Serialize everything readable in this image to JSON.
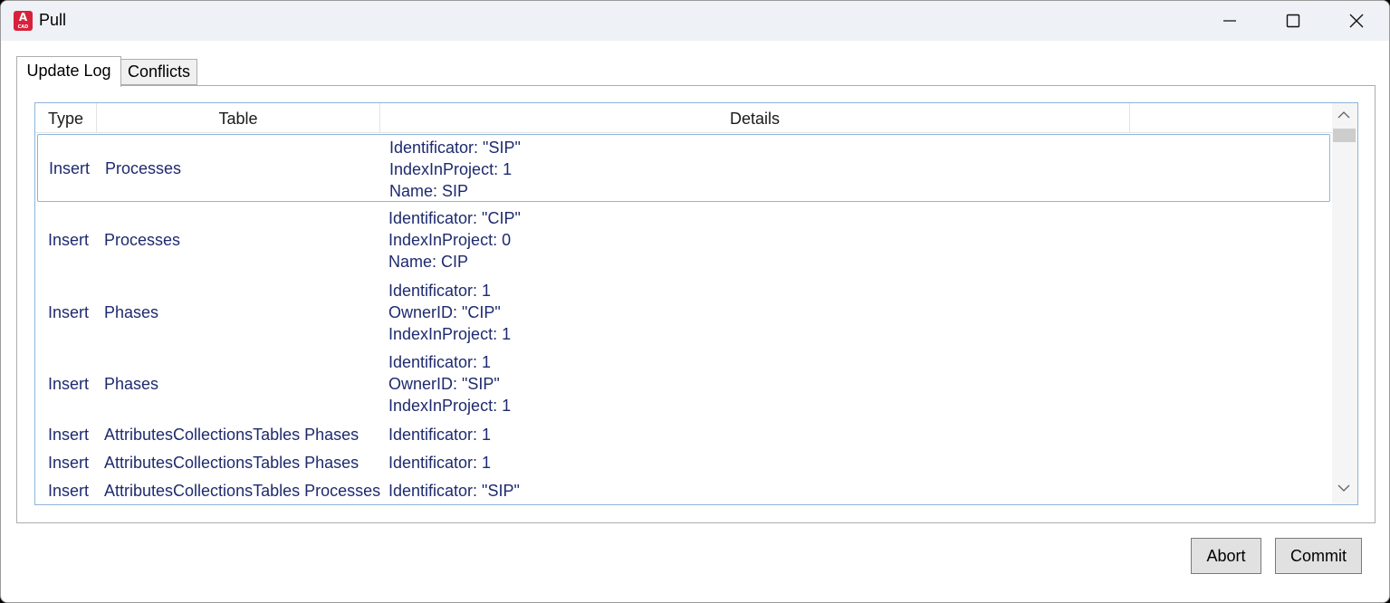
{
  "window": {
    "title": "Pull",
    "icon_letter": "A",
    "icon_sub": "CAD",
    "accent": "#d8213a"
  },
  "tabs": [
    {
      "label": "Update Log",
      "active": true
    },
    {
      "label": "Conflicts",
      "active": false
    }
  ],
  "grid": {
    "columns": [
      "Type",
      "Table",
      "Details",
      ""
    ],
    "rows": [
      {
        "type": "Insert",
        "table": "Processes",
        "details": [
          "Identificator: \"SIP\"",
          "IndexInProject: 1",
          "Name: SIP"
        ]
      },
      {
        "type": "Insert",
        "table": "Processes",
        "details": [
          "Identificator: \"CIP\"",
          "IndexInProject: 0",
          "Name: CIP"
        ]
      },
      {
        "type": "Insert",
        "table": "Phases",
        "details": [
          "Identificator: 1",
          "OwnerID: \"CIP\"",
          "IndexInProject: 1"
        ]
      },
      {
        "type": "Insert",
        "table": "Phases",
        "details": [
          "Identificator: 1",
          "OwnerID: \"SIP\"",
          "IndexInProject: 1"
        ]
      },
      {
        "type": "Insert",
        "table": "AttributesCollectionsTables Phases",
        "details": [
          "Identificator: 1"
        ]
      },
      {
        "type": "Insert",
        "table": "AttributesCollectionsTables Phases",
        "details": [
          "Identificator: 1"
        ]
      },
      {
        "type": "Insert",
        "table": "AttributesCollectionsTables Processes",
        "details": [
          "Identificator: \"SIP\""
        ]
      }
    ]
  },
  "buttons": {
    "abort": "Abort",
    "commit": "Commit"
  }
}
